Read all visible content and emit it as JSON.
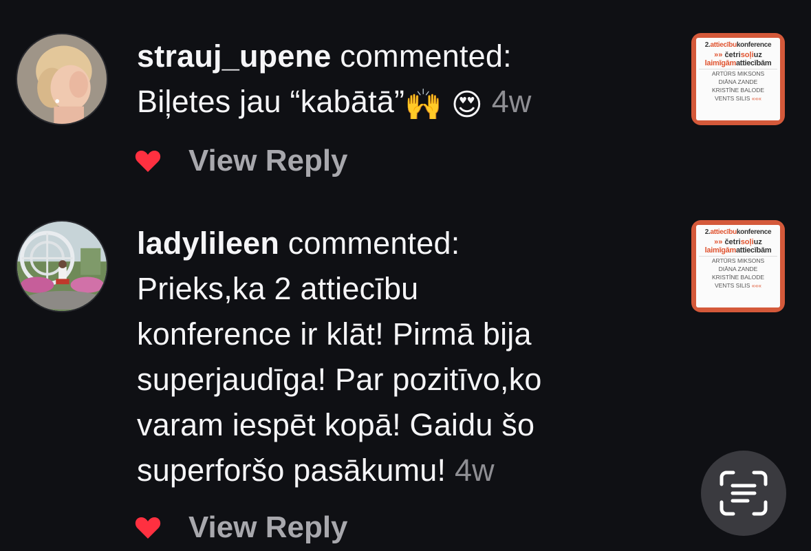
{
  "comments": [
    {
      "username": "strauj_upene",
      "action": " commented:",
      "text_lines": [
        "Biļetes jau “kabātā”"
      ],
      "emojis": [
        "🙌",
        "😍"
      ],
      "time": "4w",
      "reply_label": "View Reply",
      "thumbnail": {
        "line1_num": "2.",
        "line1_accent": "attiecību",
        "line1_rest": "konference",
        "line2_arrows": "»»",
        "line2_a": "četri",
        "line2_b": "soļi",
        "line2_c": "uz",
        "line3_a": "laimīgām",
        "line3_b": "attiecībām",
        "names": [
          "ARTŪRS MIKSONS",
          "DIĀNA ZANDE",
          "KRISTĪNE BALODE",
          "VENTS SILIS"
        ],
        "end_arrows": "«««"
      }
    },
    {
      "username": "ladylileen",
      "action": " commented:",
      "text_lines": [
        "Prieks,ka 2 attiecību",
        "konference ir klāt! Pirmā bija",
        "superjaudīga! Par pozitīvo,ko",
        "varam iespēt kopā! Gaidu šo",
        "superforšo pasākumu!"
      ],
      "time": "4w",
      "reply_label": "View Reply",
      "thumbnail": {
        "line1_num": "2.",
        "line1_accent": "attiecību",
        "line1_rest": "konference",
        "line2_arrows": "»»",
        "line2_a": "četri",
        "line2_b": "soļi",
        "line2_c": "uz",
        "line3_a": "laimīgām",
        "line3_b": "attiecībām",
        "names": [
          "ARTŪRS MIKSONS",
          "DIĀNA ZANDE",
          "KRISTĪNE BALODE",
          "VENTS SILIS"
        ],
        "end_arrows": "«««"
      }
    }
  ],
  "colors": {
    "background": "#0f1014",
    "text": "#f5f5f7",
    "muted": "#8e8e93",
    "reply": "#a8a8ad",
    "heart": "#ff3040",
    "thumb_accent": "#d4593a"
  },
  "icons": {
    "heart": "heart-icon",
    "scan": "text-scan-icon"
  }
}
